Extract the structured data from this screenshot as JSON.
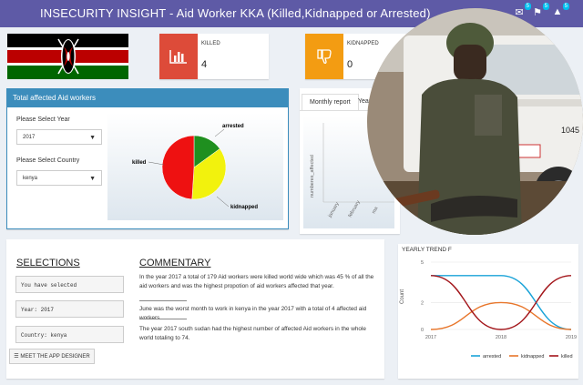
{
  "header": {
    "title": "INSECURITY INSIGHT - Aid Worker KKA (Killed,Kidnapped or Arrested)",
    "notification_counts": [
      "5",
      "5",
      "5"
    ]
  },
  "killed": {
    "label": "KILLED",
    "value": "4",
    "color": "#dd4b39",
    "icon": "bar-chart-icon"
  },
  "kidnapped": {
    "label": "KIDNAPPED",
    "value": "0",
    "color": "#f39c12",
    "icon": "thumbs-down-icon"
  },
  "filters": {
    "box_title": "Total affected Aid workers",
    "year_label": "Please Select Year",
    "year_value": "2017",
    "country_label": "Please Select Country",
    "country_value": "kenya"
  },
  "pie": {
    "labels": [
      "arrested",
      "killed",
      "kidnapped"
    ]
  },
  "monthly": {
    "tabs": [
      "Monthly report",
      "Yearl"
    ],
    "ylabel": "numberes_affected",
    "ticks": [
      "january",
      "february",
      "ma"
    ]
  },
  "selections": {
    "heading": "SELECTIONS",
    "line1": "You have selected",
    "line2": "Year:  2017",
    "line3": "Country:  kenya",
    "button": "MEET THE APP DESIGNER"
  },
  "commentary": {
    "heading": "COMMENTARY",
    "p1": "In the year 2017 a total of 179 Aid workers were killed world wide which was 45 % of all the aid workers and was the highest propotion of aid workers affected that year.",
    "p2": "June was the worst month to work in kenya in the year 2017 with a total of 4 affected aid workers",
    "p3": "The year 2017 south sudan had the highest number of affected Aid workers in the whole world totaling to 74."
  },
  "trend": {
    "title": "YEARLY TREND F",
    "ylabel": "Count",
    "colors": {
      "arrested": "#1aa3d8",
      "kidnapped": "#e8762b",
      "killed": "#a3161b"
    }
  },
  "chart_data": [
    {
      "type": "pie",
      "categories": [
        "arrested",
        "kidnapped",
        "killed"
      ],
      "values": [
        15,
        36,
        49
      ]
    },
    {
      "type": "line",
      "categories": [
        "2017",
        "2018",
        "2019"
      ],
      "ylim": [
        0,
        5
      ],
      "yticks": [
        "0",
        "2",
        "5"
      ],
      "series": [
        {
          "name": "arrested",
          "values": [
            4,
            4,
            0
          ]
        },
        {
          "name": "kidnapped",
          "values": [
            0,
            2,
            0
          ]
        },
        {
          "name": "killed",
          "values": [
            4,
            0,
            4
          ]
        }
      ]
    }
  ]
}
